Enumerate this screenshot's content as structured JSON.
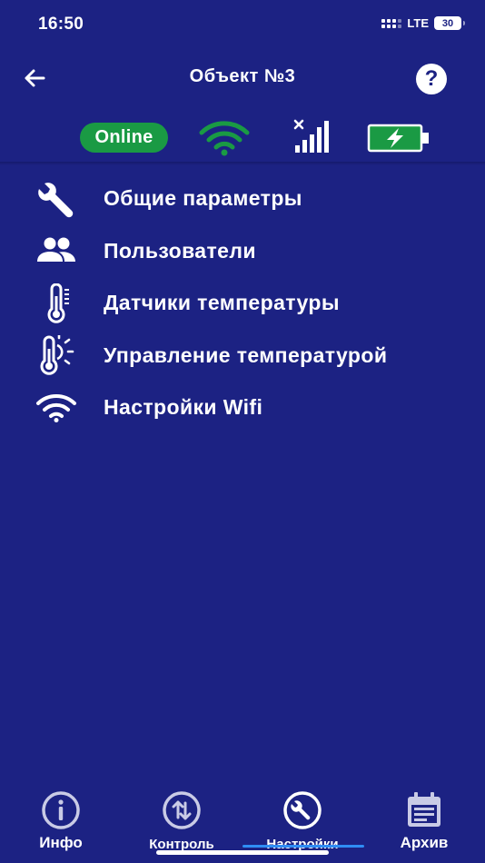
{
  "status_bar": {
    "time": "16:50",
    "network": "LTE",
    "battery_level": "30"
  },
  "header": {
    "title": "Объект №3",
    "back_icon": "arrow-left-icon",
    "help_label": "?"
  },
  "indicators": {
    "online_label": "Online",
    "wifi_icon": "wifi-icon",
    "gsm_icon": "gsm-signal-no-service-icon",
    "battery_icon": "battery-charging-icon",
    "colors": {
      "online": "#1a9a44",
      "wifi": "#1a9a44",
      "battery": "#1a9a44"
    }
  },
  "menu": {
    "items": [
      {
        "label": "Общие параметры",
        "icon": "wrench-icon"
      },
      {
        "label": "Пользователи",
        "icon": "users-icon"
      },
      {
        "label": "Датчики температуры",
        "icon": "thermometer-icon"
      },
      {
        "label": "Управление температурой",
        "icon": "thermometer-sun-icon"
      },
      {
        "label": "Настройки Wifi",
        "icon": "wifi-icon"
      }
    ]
  },
  "tabbar": {
    "tabs": [
      {
        "label": "Инфо",
        "icon": "info-icon",
        "active": false
      },
      {
        "label": "Контроль",
        "icon": "control-arrows-icon",
        "active": false
      },
      {
        "label": "Настройки",
        "icon": "wrench-circle-icon",
        "active": true
      },
      {
        "label": "Архив",
        "icon": "calendar-list-icon",
        "active": false
      }
    ]
  },
  "theme": {
    "background": "#1c2283",
    "accent": "#2f8df5",
    "foreground": "#ffffff"
  }
}
